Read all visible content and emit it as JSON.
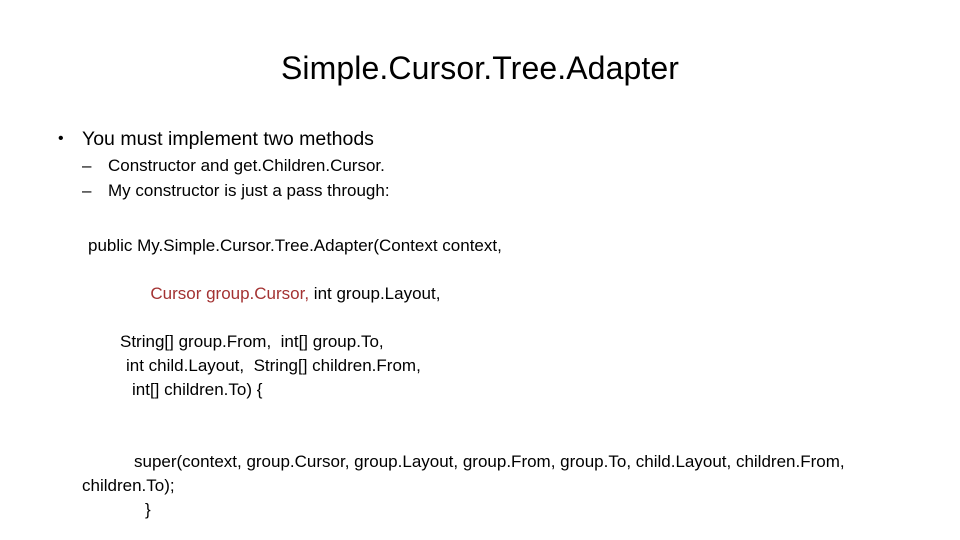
{
  "slide": {
    "title": "Simple.Cursor.Tree.Adapter",
    "bullets": {
      "level1": {
        "marker": "•",
        "text": "You must implement two methods"
      },
      "level2": [
        {
          "marker": "–",
          "text": "Constructor and get.Children.Cursor."
        },
        {
          "marker": "–",
          "text": "My constructor is just a pass through:"
        }
      ]
    },
    "code": {
      "line1": "public My.Simple.Cursor.Tree.Adapter(Context context,",
      "line2_red": "Cursor group.Cursor,",
      "line2_black": " int group.Layout,",
      "line3": "String[] group.From,  int[] group.To,",
      "line4": "int child.Layout,  String[] children.From,",
      "line5": "int[] children.To) {",
      "line6": "super(context, group.Cursor, group.Layout, group.From, group.To, child.Layout, children.From,  children.To);",
      "line7": "}"
    }
  },
  "colors": {
    "background": "#ffffff",
    "text": "#000000",
    "highlight_red": "#A33232"
  }
}
